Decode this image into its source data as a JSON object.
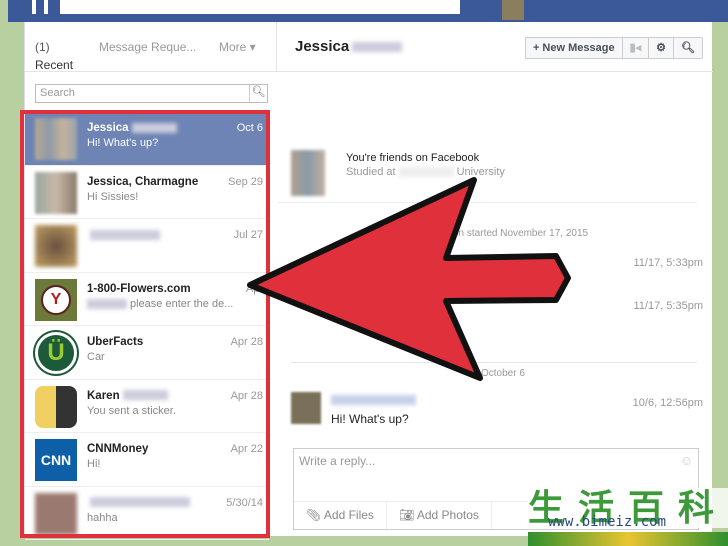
{
  "sidebar": {
    "tabs": {
      "recent": "Recent",
      "recent_count": "(1)",
      "requests": "Message Reque...",
      "more": "More ▾"
    },
    "search_placeholder": "Search",
    "threads": [
      {
        "name": "Jessica",
        "preview": "Hi! What's up?",
        "date": "Oct 6",
        "selected": true
      },
      {
        "name": "Jessica, Charmagne",
        "preview": "Hi Sissies!",
        "date": "Sep 29"
      },
      {
        "name": "",
        "preview": "",
        "date": "Jul 27"
      },
      {
        "name": "1-800-Flowers.com",
        "preview": "please enter the de...",
        "date": "Apr"
      },
      {
        "name": "UberFacts",
        "preview": "Car",
        "date": "Apr 28"
      },
      {
        "name": "Karen",
        "preview": "You sent a sticker.",
        "date": "Apr 28"
      },
      {
        "name": "CNNMoney",
        "preview": "Hi!",
        "date": "Apr 22"
      },
      {
        "name": "",
        "preview": "hahha",
        "date": "5/30/14"
      }
    ]
  },
  "conversation": {
    "title": "Jessica",
    "new_message": "+ New Message",
    "friends_line": "You're friends on Facebook",
    "studied_prefix": "Studied at",
    "studied_suffix": "University",
    "started": "on started November 17, 2015",
    "time1": "11/17, 5:33pm",
    "time2": "11/17, 5:35pm",
    "divider": "October 6",
    "time3": "10/6, 12:56pm",
    "last_message": "Hi! What's up?"
  },
  "composer": {
    "placeholder": "Write a reply...",
    "add_files": "Add Files",
    "add_photos": "Add Photos"
  },
  "watermark": {
    "chinese": "生活百科",
    "url": "www.bimeiz.com"
  },
  "colors": {
    "fb_blue": "#3b5998",
    "selected": "#6d84b4",
    "highlight": "#e0303c",
    "background": "#b8cfa0"
  }
}
